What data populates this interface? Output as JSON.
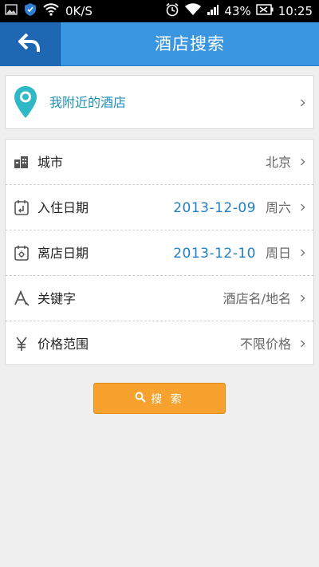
{
  "status_bar": {
    "speed": "0K/S",
    "battery": "43%",
    "time": "10:25"
  },
  "header": {
    "title": "酒店搜索",
    "back_icon": "back-arrow-icon"
  },
  "nearby": {
    "label": "我附近的酒店",
    "icon": "location-pin-icon",
    "accent": "#1f8fb5"
  },
  "form": {
    "city": {
      "label": "城市",
      "value": "北京",
      "icon": "buildings-icon"
    },
    "checkin": {
      "label": "入住日期",
      "date": "2013-12-09",
      "weekday": "周六",
      "icon": "checkin-calendar-icon"
    },
    "checkout": {
      "label": "离店日期",
      "date": "2013-12-10",
      "weekday": "周日",
      "icon": "checkout-calendar-icon"
    },
    "keyword": {
      "label": "关键字",
      "placeholder": "酒店名/地名",
      "icon": "font-a-icon"
    },
    "price": {
      "label": "价格范围",
      "value": "不限价格",
      "icon": "yen-icon"
    }
  },
  "search": {
    "label": "搜 索",
    "color": "#f7a12e",
    "icon": "search-icon"
  }
}
